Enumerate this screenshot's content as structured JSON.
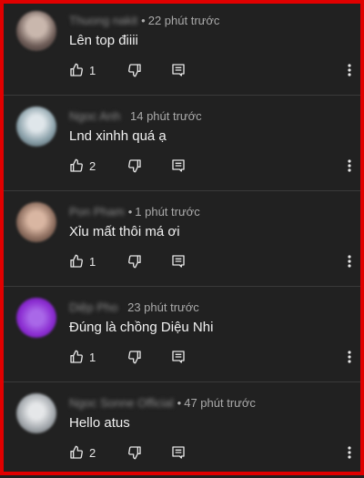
{
  "comments": [
    {
      "author": "Thuong nakit",
      "time": "22 phút trước",
      "text": "Lên top điiii",
      "likes": "1",
      "avatar_color": "#8c7f7a"
    },
    {
      "author": "Ngoc Anh",
      "time": "14 phút trước",
      "text": "Lnd xinhh quá ạ",
      "likes": "2",
      "avatar_color": "#b7c4c9"
    },
    {
      "author": "Pon Pham",
      "time": "1 phút trước",
      "text": "Xỉu mất thôi má ơi",
      "likes": "1",
      "avatar_color": "#a98a7d"
    },
    {
      "author": "Diệp Pho",
      "time": "23 phút trước",
      "text": "Đúng là chồng Diệu Nhi",
      "likes": "1",
      "avatar_color": "#8a2bd0"
    },
    {
      "author": "Ngoc Sonne Official",
      "time": "47 phút trước",
      "text": "Hello atus",
      "likes": "2",
      "avatar_color": "#c6c9cc"
    }
  ],
  "icons": {
    "like": "thumb-up-icon",
    "dislike": "thumb-down-icon",
    "reply": "reply-icon",
    "more": "more-vert-icon"
  },
  "colors": {
    "background": "#212121",
    "border": "#e00000",
    "text": "#f1f1f1",
    "meta": "#aaaaaa"
  }
}
